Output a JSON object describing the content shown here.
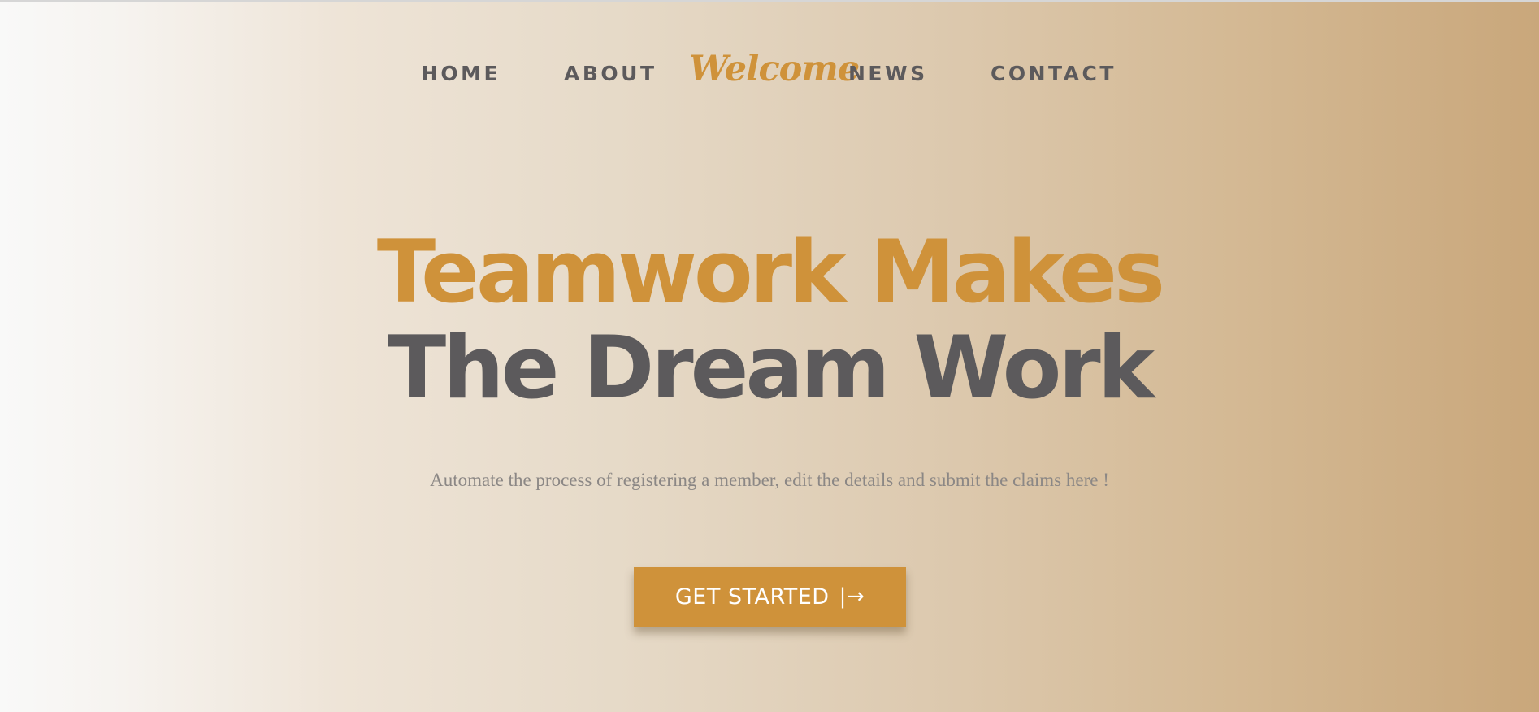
{
  "nav": {
    "items": [
      {
        "label": "HOME"
      },
      {
        "label": "ABOUT"
      },
      {
        "label": "NEWS"
      },
      {
        "label": "CONTACT"
      }
    ],
    "brand": "Welcome"
  },
  "hero": {
    "headline_line1": "Teamwork Makes",
    "headline_line2": "The Dream Work",
    "subtitle": "Automate the process of registering a member, edit the details and submit the claims here !",
    "cta_label": "GET STARTED",
    "cta_icon": "|→",
    "cta_icon_name": "arrow-right-to-bar-icon"
  },
  "colors": {
    "accent": "#cf923a",
    "text_dark": "#5c5a5c",
    "text_muted": "#8b8785",
    "background_left": "#f9f9f8",
    "background_right": "#c9a77b"
  }
}
